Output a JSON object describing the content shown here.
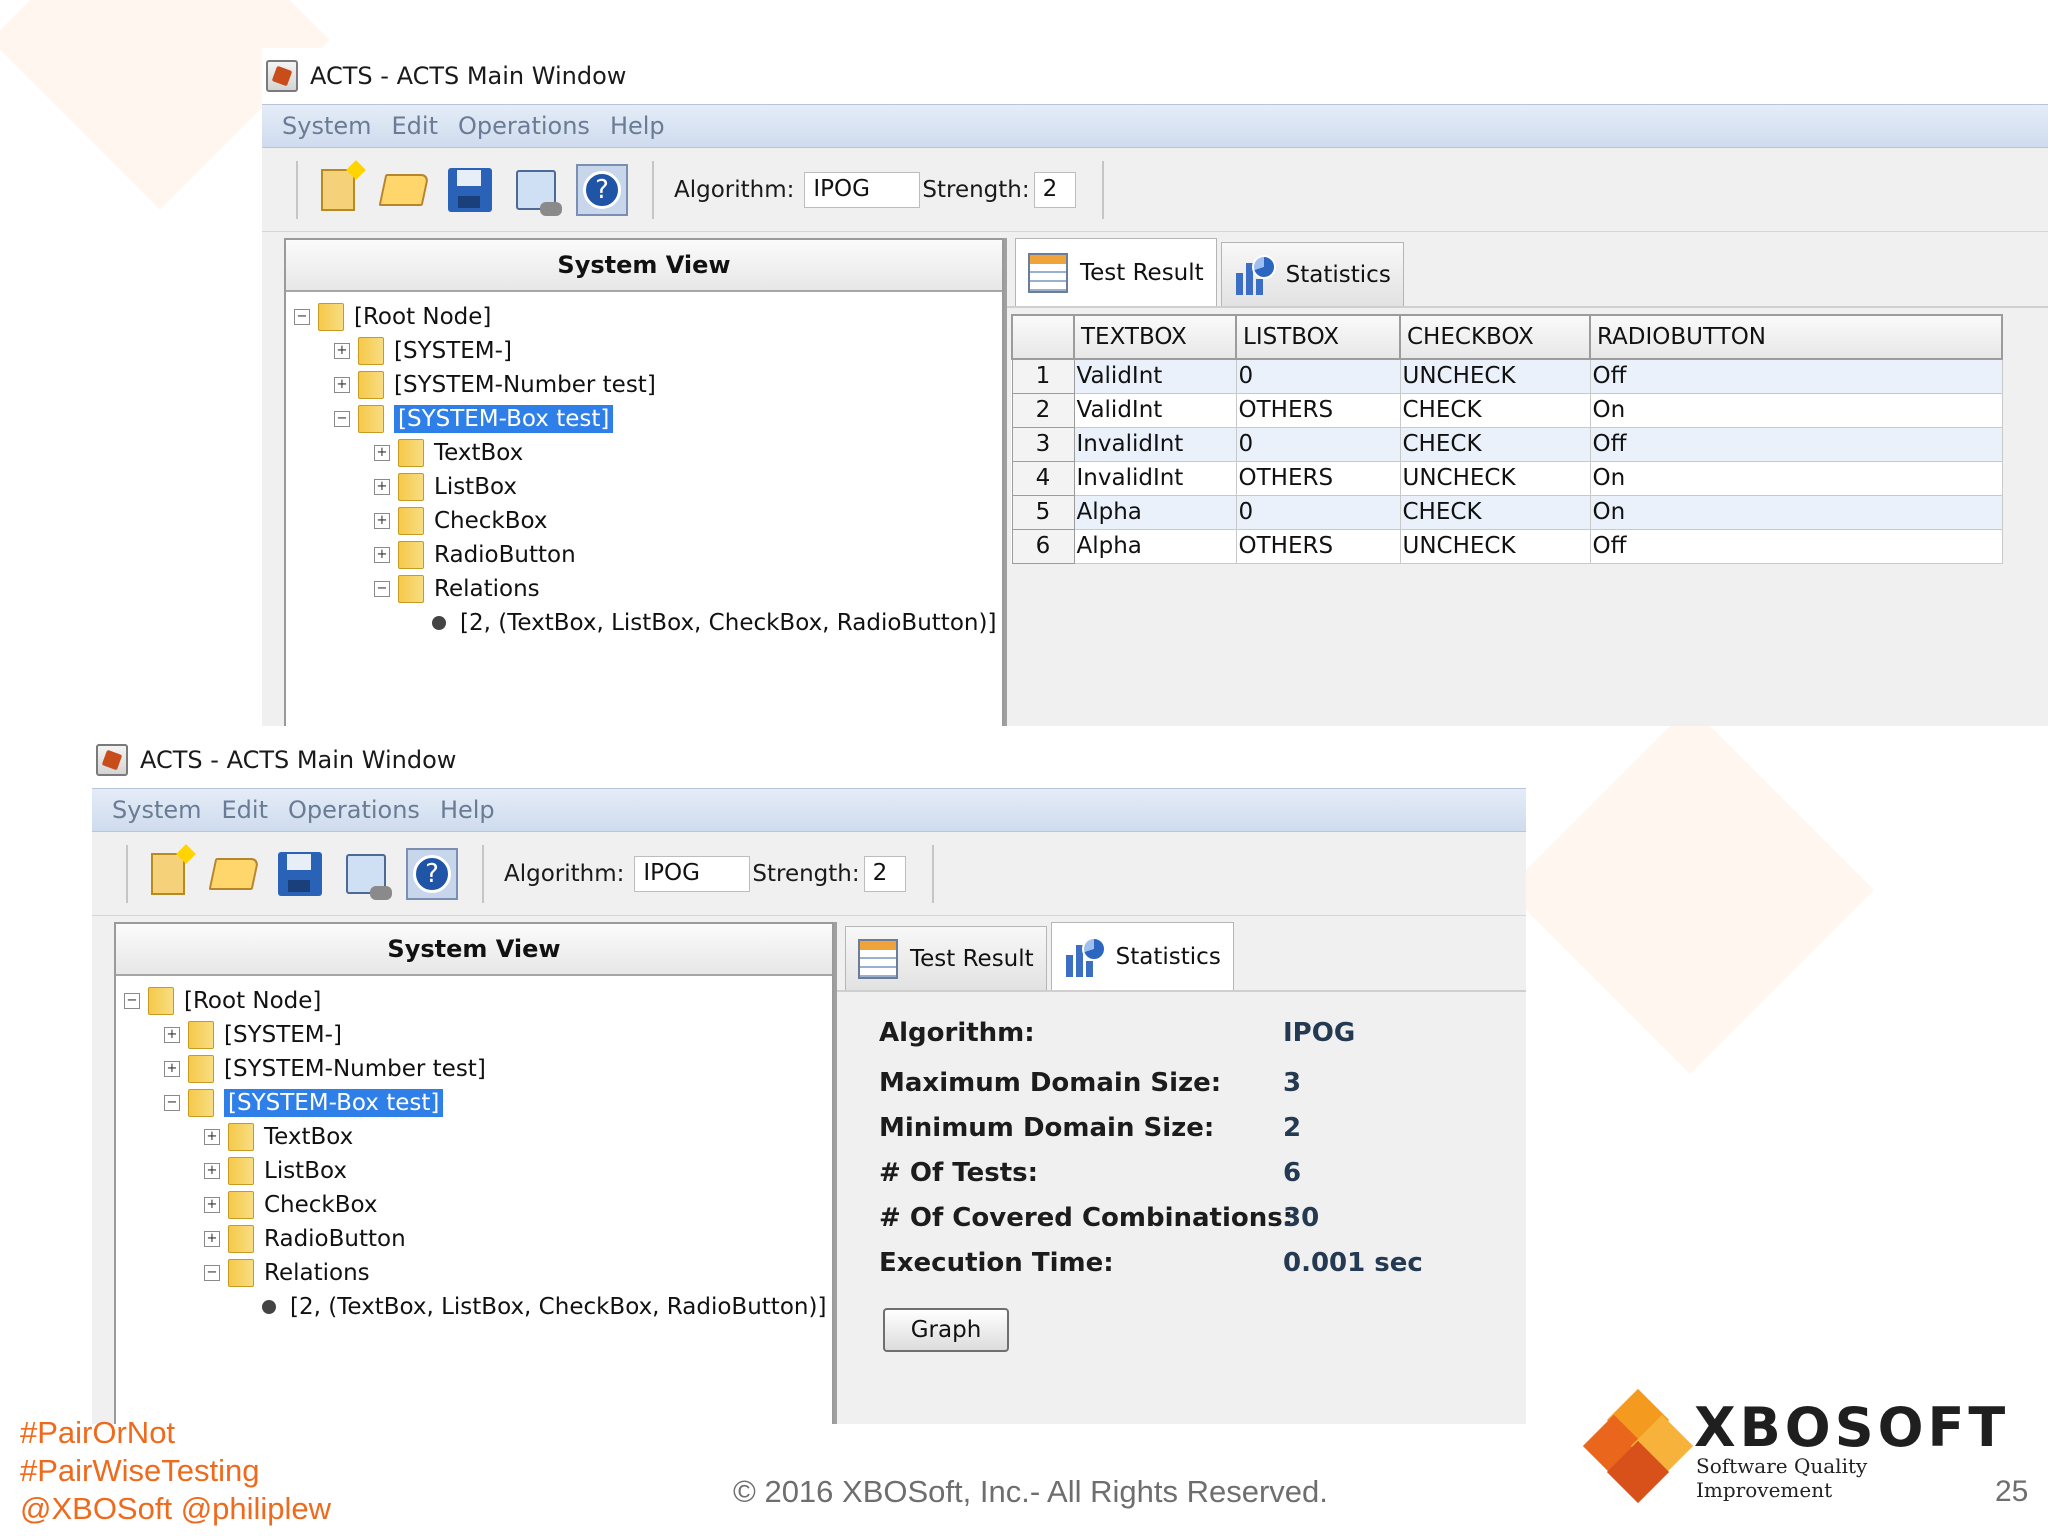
{
  "window": {
    "title": "ACTS - ACTS Main Window",
    "menu": [
      "System",
      "Edit",
      "Operations",
      "Help"
    ],
    "toolbar": {
      "algorithm_label": "Algorithm:",
      "algorithm_value": "IPOG",
      "strength_label": "Strength:",
      "strength_value": "2",
      "icons": [
        "new-system-icon",
        "open-folder-icon",
        "save-icon",
        "build-icon",
        "help-icon"
      ]
    }
  },
  "system_view": {
    "header": "System View",
    "tree": {
      "root": "[Root Node]",
      "system": "[SYSTEM-]",
      "number_test": "[SYSTEM-Number test]",
      "box_test": "[SYSTEM-Box test]",
      "params": [
        "TextBox",
        "ListBox",
        "CheckBox",
        "RadioButton"
      ],
      "relations": "Relations",
      "relation_item": "[2, (TextBox, ListBox, CheckBox, RadioButton)]"
    }
  },
  "tabs": {
    "test_result": "Test Result",
    "statistics": "Statistics"
  },
  "test_result": {
    "columns": [
      "TEXTBOX",
      "LISTBOX",
      "CHECKBOX",
      "RADIOBUTTON"
    ],
    "rows": [
      {
        "n": "1",
        "cells": [
          "ValidInt",
          "0",
          "UNCHECK",
          "Off"
        ]
      },
      {
        "n": "2",
        "cells": [
          "ValidInt",
          "OTHERS",
          "CHECK",
          "On"
        ]
      },
      {
        "n": "3",
        "cells": [
          "InvalidInt",
          "0",
          "CHECK",
          "Off"
        ]
      },
      {
        "n": "4",
        "cells": [
          "InvalidInt",
          "OTHERS",
          "UNCHECK",
          "On"
        ]
      },
      {
        "n": "5",
        "cells": [
          "Alpha",
          "0",
          "CHECK",
          "On"
        ]
      },
      {
        "n": "6",
        "cells": [
          "Alpha",
          "OTHERS",
          "UNCHECK",
          "Off"
        ]
      }
    ]
  },
  "statistics": {
    "rows": [
      {
        "label": "Algorithm:",
        "value": "IPOG"
      },
      {
        "label": "Maximum Domain Size:",
        "value": "3"
      },
      {
        "label": "Minimum Domain Size:",
        "value": "2"
      },
      {
        "label": "# Of Tests:",
        "value": "6"
      },
      {
        "label": "# Of Covered Combinations:",
        "value": "30"
      },
      {
        "label": "Execution Time:",
        "value": "0.001 sec"
      }
    ],
    "graph_button": "Graph"
  },
  "slide": {
    "hashtags": [
      "#PairOrNot",
      "#PairWiseTesting",
      "@XBOSoft @philiplew"
    ],
    "copyright": "© 2016 XBOSoft, Inc.- All Rights Reserved.",
    "page_number": "25",
    "logo_name": "XBOSOFT",
    "logo_tagline": "Software Quality Improvement",
    "colors": {
      "accent": "#ee6a1d",
      "selection": "#2f7fe8"
    }
  }
}
